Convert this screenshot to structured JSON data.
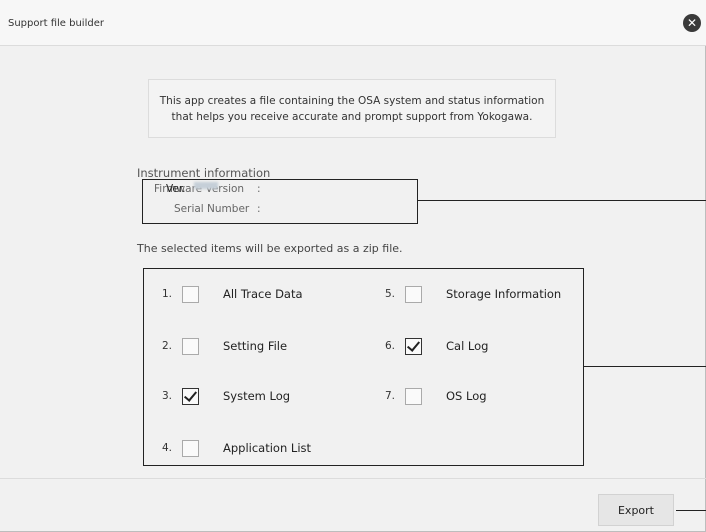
{
  "window": {
    "title": "Support file builder"
  },
  "close_icon": "close-icon",
  "intro": {
    "line1": "This app creates a file containing the OSA system and status information",
    "line2": "that helps you receive accurate and prompt support from Yokogawa."
  },
  "instrument": {
    "header": "Instrument information",
    "firmware_label": "Firmware Version",
    "serial_label": "Serial Number",
    "separator": ":",
    "firmware_prefix": "Ver."
  },
  "export_message": "The selected items will be exported as a zip file.",
  "items": [
    {
      "num": "1.",
      "label": "All Trace Data",
      "checked": false
    },
    {
      "num": "2.",
      "label": "Setting File",
      "checked": false
    },
    {
      "num": "3.",
      "label": "System Log",
      "checked": true
    },
    {
      "num": "4.",
      "label": "Application List",
      "checked": false
    },
    {
      "num": "5.",
      "label": "Storage Information",
      "checked": false
    },
    {
      "num": "6.",
      "label": "Cal Log",
      "checked": true
    },
    {
      "num": "7.",
      "label": "OS Log",
      "checked": false
    }
  ],
  "export_button": "Export"
}
